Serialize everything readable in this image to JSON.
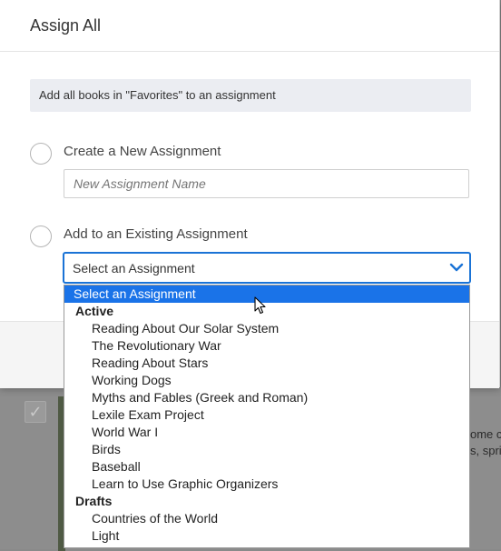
{
  "background": {
    "snippet_line_1": "ome c",
    "snippet_line_2": "s, spri"
  },
  "modal": {
    "title": "Assign All",
    "info": "Add all books in \"Favorites\" to an assignment",
    "create_option_label": "Create a New Assignment",
    "new_assignment_placeholder": "New Assignment Name",
    "existing_option_label": "Add to an Existing Assignment",
    "select_value": "Select an Assignment"
  },
  "dropdown": {
    "selected": "Select an Assignment",
    "groups": [
      {
        "label": "Active",
        "options": [
          "Reading About Our Solar System",
          "The Revolutionary War",
          "Reading About Stars",
          "Working Dogs",
          "Myths and Fables (Greek and Roman)",
          "Lexile Exam Project",
          "World War I",
          "Birds",
          "Baseball",
          "Learn to Use Graphic Organizers"
        ]
      },
      {
        "label": "Drafts",
        "options": [
          "Countries of the World",
          "Light"
        ]
      }
    ]
  },
  "colors": {
    "accent": "#1a73e8",
    "overlay": "#7f8080"
  }
}
